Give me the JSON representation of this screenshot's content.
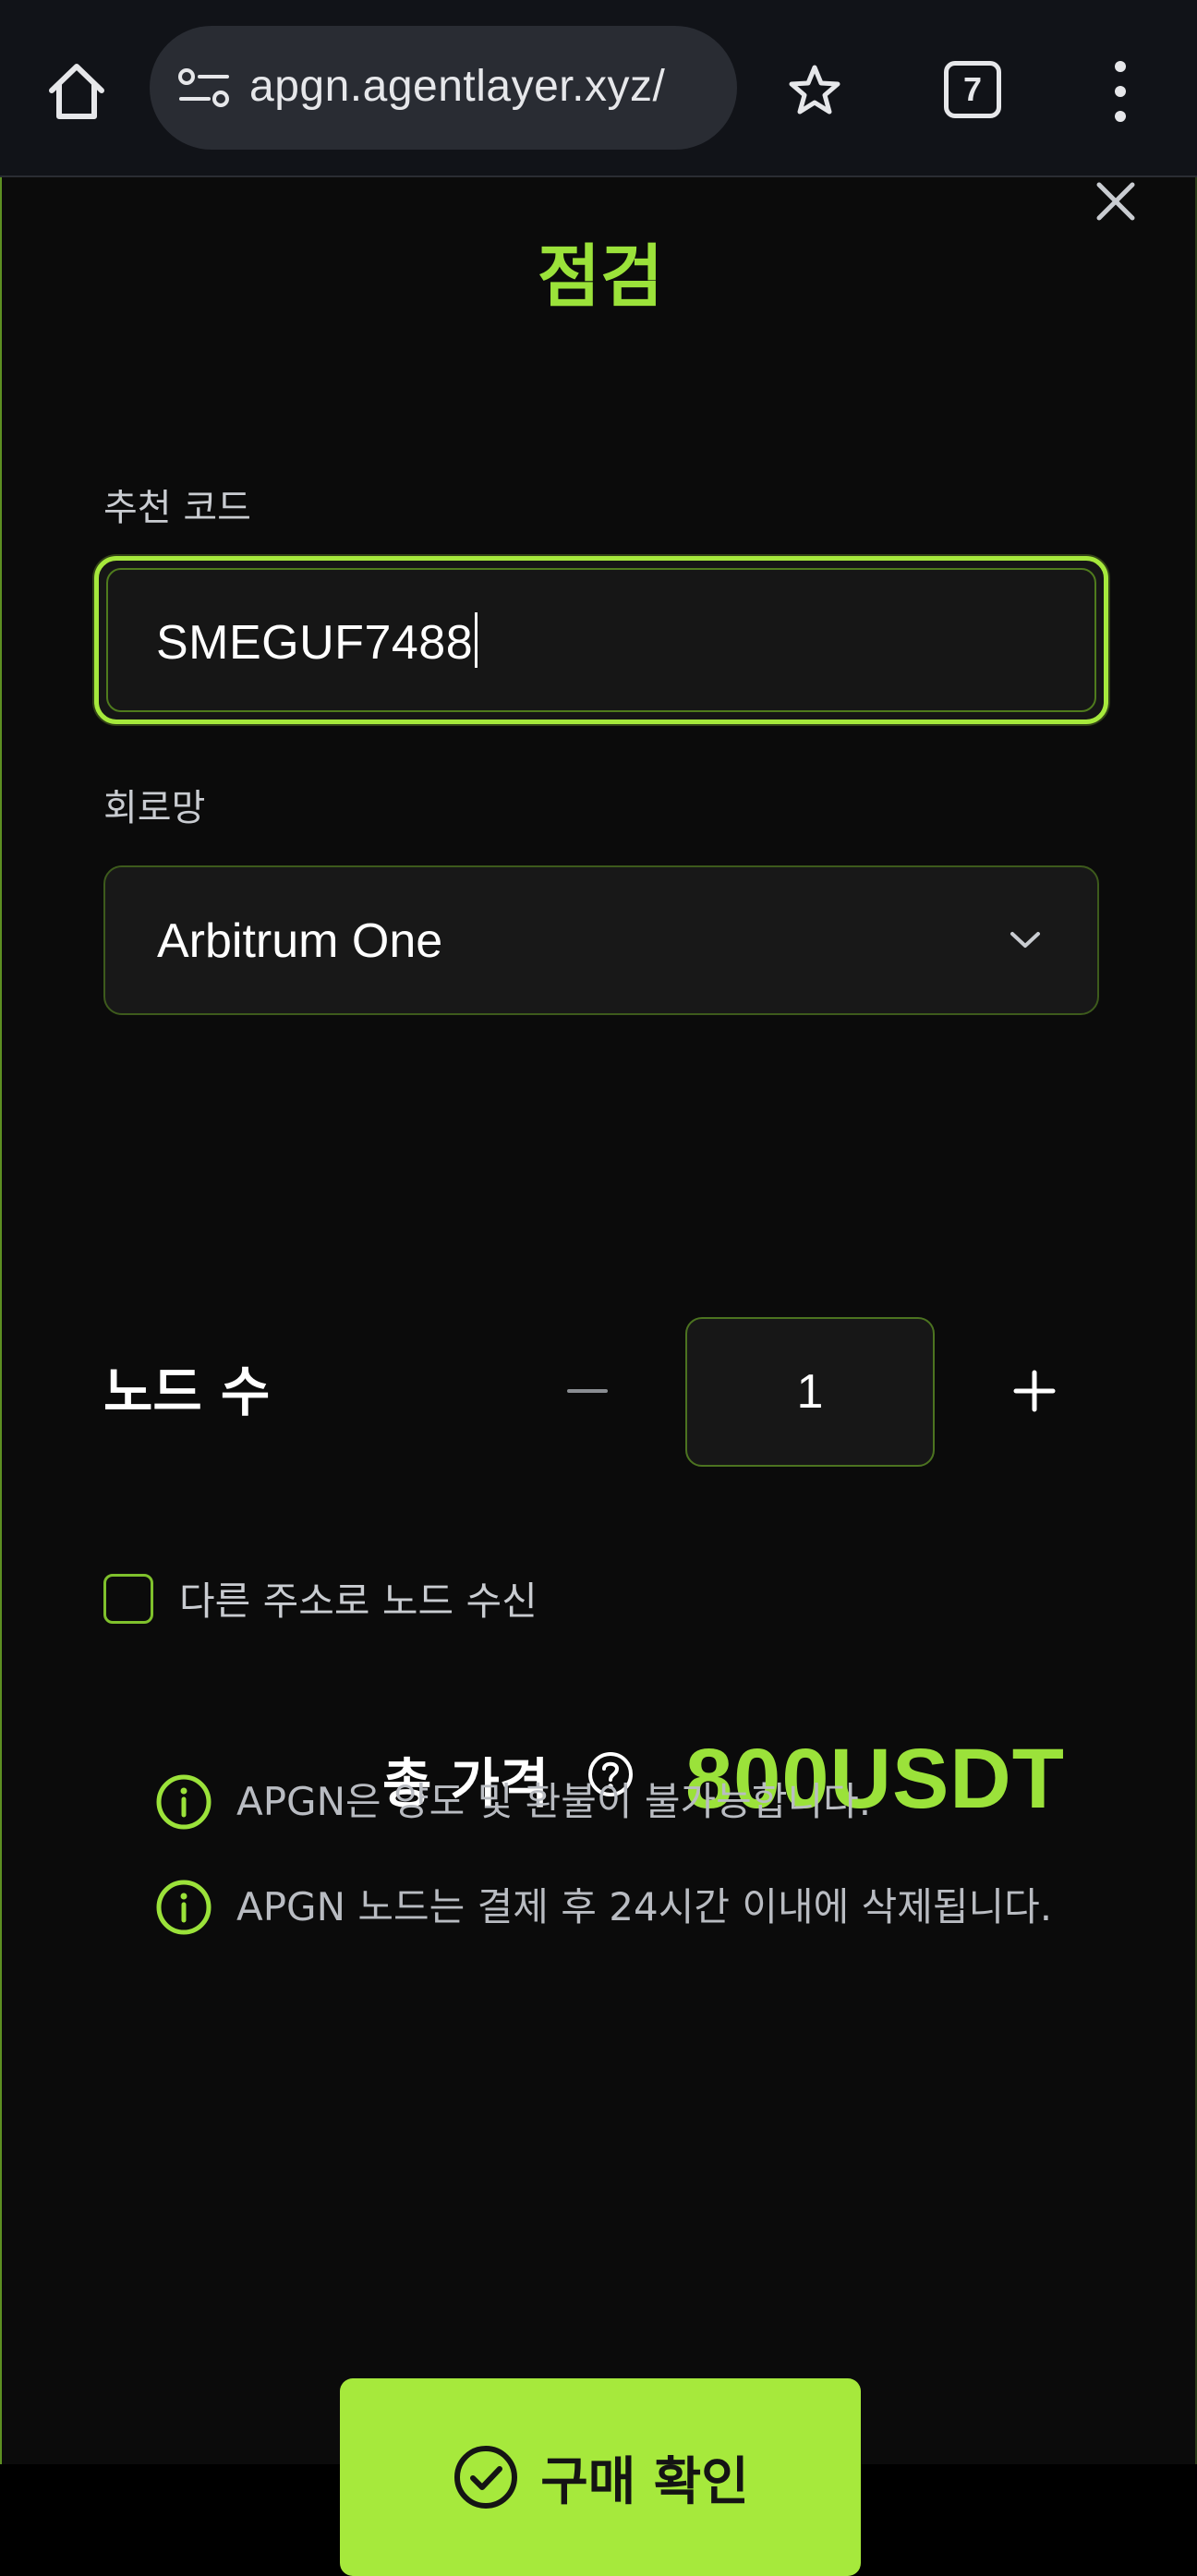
{
  "browser": {
    "url": "apgn.agentlayer.xyz/",
    "tab_count": "7"
  },
  "modal": {
    "title": "점검",
    "referral": {
      "label": "추천 코드",
      "value": "SMEGUF7488"
    },
    "network": {
      "label": "회로망",
      "selected": "Arbitrum One"
    },
    "nodes": {
      "label": "노드 수",
      "quantity": "1"
    },
    "alt_address": {
      "label": "다른 주소로 노드 수신",
      "checked": false
    },
    "total": {
      "label": "총 가격",
      "value": "800USDT"
    },
    "notices": [
      "APGN은 양도 및 환불이 불가능합니다.",
      "APGN 노드는 결제 후 24시간 이내에 삭제됩니다."
    ],
    "confirm_label": "구매 확인"
  },
  "colors": {
    "accent": "#a6e93c",
    "background": "#0b0b0b"
  }
}
